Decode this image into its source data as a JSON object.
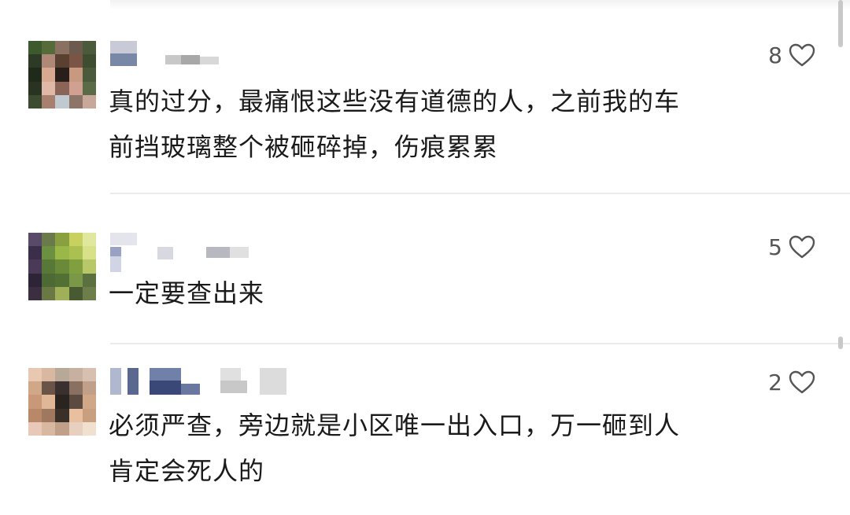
{
  "comments": [
    {
      "text": "真的过分，最痛恨这些没有道德的人，之前我的车\n前挡玻璃整个被砸碎掉，伤痕累累",
      "likes": "8",
      "avatar": "blurred-avatar",
      "username": "blurred-username"
    },
    {
      "text": "一定要查出来",
      "likes": "5",
      "avatar": "blurred-avatar",
      "username": "blurred-username"
    },
    {
      "text": "必须严查，旁边就是小区唯一出入口，万一砸到人\n肯定会死人的",
      "likes": "2",
      "avatar": "blurred-avatar",
      "username": "blurred-username"
    }
  ],
  "icons": {
    "like": "heart-outline-icon"
  },
  "colors": {
    "text": "#1a1a1a",
    "like_count": "#555555",
    "divider": "#ebebeb"
  }
}
